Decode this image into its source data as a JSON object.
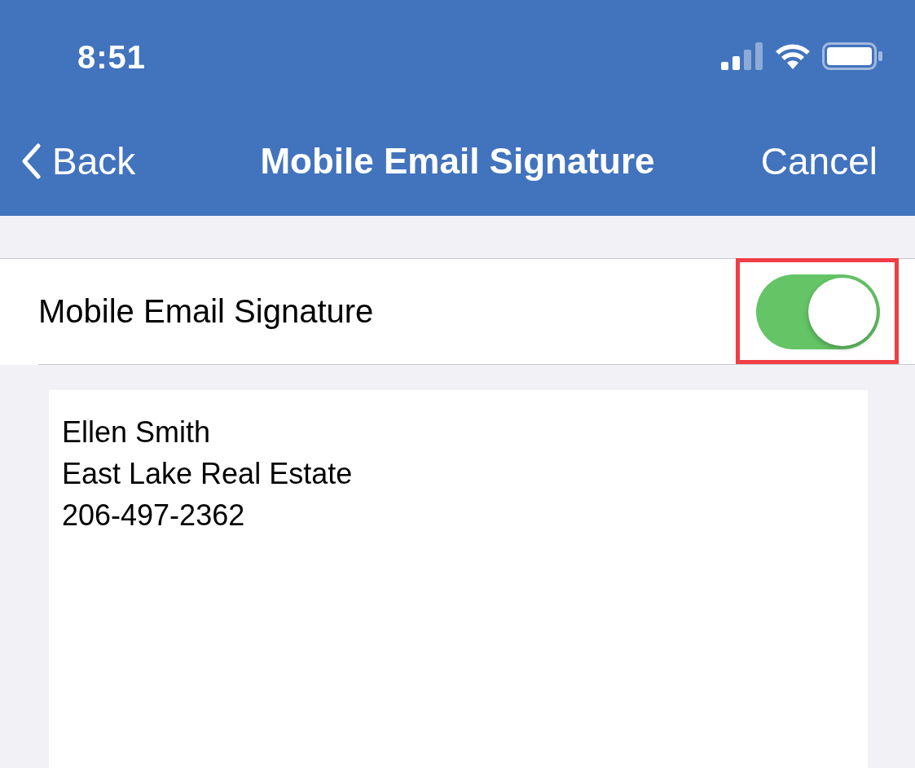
{
  "status_bar": {
    "time": "8:51"
  },
  "nav_bar": {
    "back": "Back",
    "title": "Mobile Email Signature",
    "action": "Cancel"
  },
  "toggle_row": {
    "label": "Mobile Email Signature",
    "on": true,
    "highlighted": true
  },
  "signature": {
    "lines": [
      "Ellen Smith",
      "East Lake Real Estate",
      "206-497-2362"
    ]
  }
}
